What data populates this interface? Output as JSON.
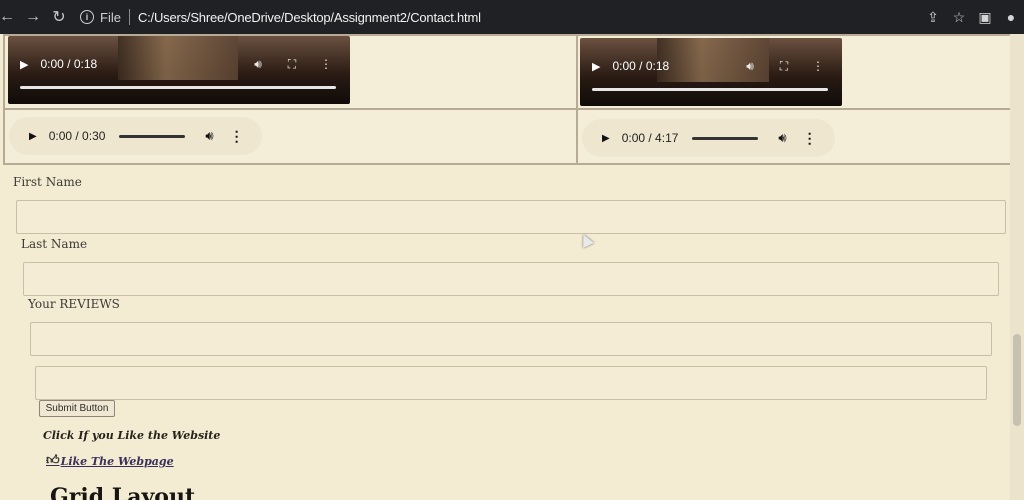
{
  "browser": {
    "back_icon": "back-arrow-icon",
    "forward_icon": "forward-arrow-icon",
    "reload_icon": "reload-icon",
    "file_label": "File",
    "url": "C:/Users/Shree/OneDrive/Desktop/Assignment2/Contact.html",
    "tool_icons": [
      "share-icon",
      "star-icon",
      "sidebar-icon",
      "profile-icon"
    ]
  },
  "media": {
    "videos": [
      {
        "time": "0:00 / 0:18"
      },
      {
        "time": "0:00 / 0:18"
      }
    ],
    "audios": [
      {
        "time": "0:00 / 0:30"
      },
      {
        "time": "0:00 / 4:17"
      }
    ]
  },
  "form": {
    "first_name_label": "First Name",
    "last_name_label": "Last Name",
    "reviews_label": "Your REVIEWS",
    "submit_label": "Submit Button"
  },
  "content": {
    "like_note": "Click If you Like the Website",
    "like_link": "Like The Webpage",
    "grid_heading": "Grid Layout"
  },
  "colors": {
    "page_background": "#f3ebd2",
    "browser_bar": "#202124"
  }
}
